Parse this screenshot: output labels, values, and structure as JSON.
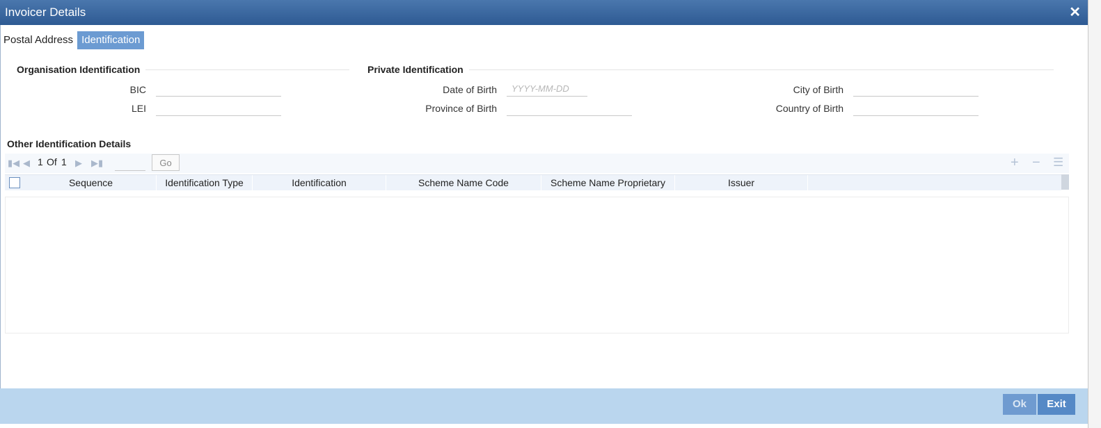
{
  "window": {
    "title": "Invoicer Details",
    "close_glyph": "✕"
  },
  "tabs": [
    {
      "label": "Postal Address",
      "active": false
    },
    {
      "label": "Identification",
      "active": true
    }
  ],
  "organisation": {
    "title": "Organisation Identification",
    "bic_label": "BIC",
    "bic_value": "",
    "lei_label": "LEI",
    "lei_value": ""
  },
  "private": {
    "title": "Private Identification",
    "dob_label": "Date of Birth",
    "dob_placeholder": "YYYY-MM-DD",
    "province_label": "Province of Birth",
    "city_label": "City of Birth",
    "country_label": "Country of Birth"
  },
  "other": {
    "title": "Other Identification Details",
    "pager": {
      "current": "1",
      "of_label": "Of",
      "total": "1",
      "go_label": "Go"
    },
    "columns": [
      "Sequence",
      "Identification Type",
      "Identification",
      "Scheme Name Code",
      "Scheme Name Proprietary",
      "Issuer"
    ],
    "rows": []
  },
  "icons": {
    "first": "first-page-icon",
    "prev": "prev-page-icon",
    "next": "next-page-icon",
    "last": "last-page-icon",
    "add": "add-row-icon",
    "delete": "delete-row-icon",
    "view": "single-view-icon"
  },
  "footer": {
    "ok_label": "Ok",
    "exit_label": "Exit"
  },
  "colors": {
    "title_bar": "#2e5a93",
    "active_tab": "#6c9bd2",
    "footer": "#bad6ee",
    "button": "#5589c6"
  }
}
